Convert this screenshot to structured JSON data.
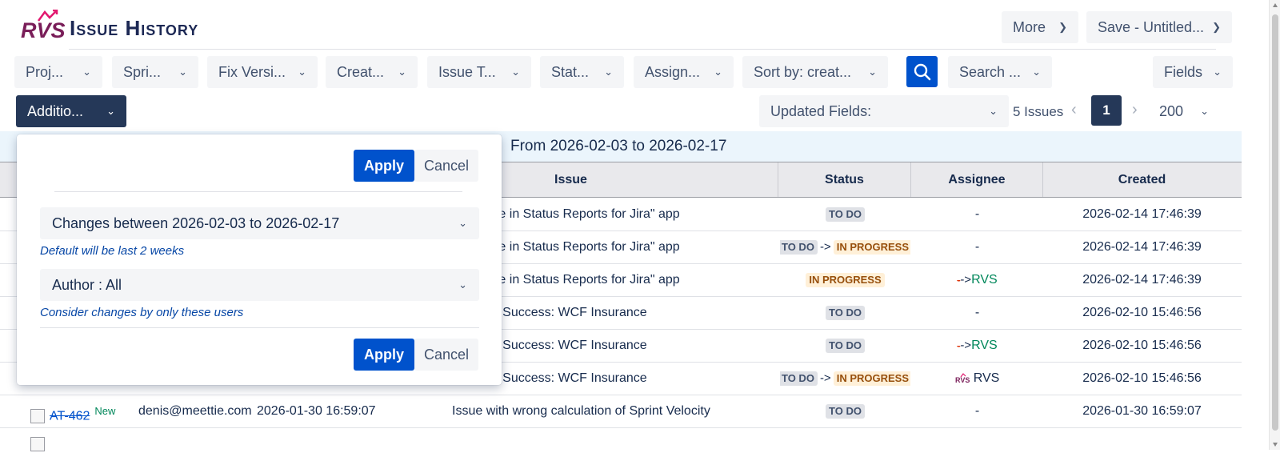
{
  "app": {
    "logo_text": "RVS",
    "title": "Issue History"
  },
  "header": {
    "more_label": "More",
    "save_label": "Save - Untitled..."
  },
  "filters": {
    "project": "Proj...",
    "sprint": "Spri...",
    "fix_version": "Fix Versi...",
    "created": "Creat...",
    "issue_type": "Issue T...",
    "status": "Stat...",
    "assignee": "Assign...",
    "sort_by": "Sort by: creat...",
    "search": "Search ...",
    "fields": "Fields",
    "additional": "Additio...",
    "updated_fields": "Updated Fields:"
  },
  "pager": {
    "issues_count": "5 Issues",
    "current_page": "1",
    "page_size": "200",
    "prev": "‹",
    "next": "›"
  },
  "banner": {
    "text": "From 2026-02-03 to 2026-02-17"
  },
  "table": {
    "headers": {
      "issue": "Issue",
      "status": "Status",
      "assignee": "Assignee",
      "created": "Created"
    },
    "rows": [
      {
        "issue": "the \"Time in Status Reports for Jira\" app",
        "status_from": "TO DO",
        "status_to": "",
        "assignee_old": "",
        "assignee_new": "-",
        "created": "2026-02-14 17:46:39"
      },
      {
        "issue": "the \"Time in Status Reports for Jira\" app",
        "status_from": "TO DO",
        "status_to": "IN PROGRESS",
        "assignee_old": "",
        "assignee_new": "-",
        "created": "2026-02-14 17:46:39"
      },
      {
        "issue": "the \"Time in Status Reports for Jira\" app",
        "status_from": "IN PROGRESS",
        "status_to": "",
        "assignee_old": "-",
        "assignee_new": "RVS",
        "created": "2026-02-14 17:46:39"
      },
      {
        "issue": "ering for Success: WCF Insurance",
        "status_from": "TO DO",
        "status_to": "",
        "assignee_old": "",
        "assignee_new": "-",
        "created": "2026-02-10 15:46:56"
      },
      {
        "issue": "ering for Success: WCF Insurance",
        "status_from": "TO DO",
        "status_to": "",
        "assignee_old": "-",
        "assignee_new": "RVS",
        "created": "2026-02-10 15:46:56"
      },
      {
        "issue": "ering for Success: WCF Insurance",
        "status_from": "TO DO",
        "status_to": "IN PROGRESS",
        "assignee_old": "",
        "assignee_new": "RVS",
        "created": "2026-02-10 15:46:56"
      },
      {
        "key": "AT-462",
        "new_tag": "New",
        "author": "denis@meettie.com",
        "date": "2026-01-30 16:59:07",
        "issue": "Issue with wrong calculation of Sprint Velocity",
        "status_from": "TO DO",
        "status_to": "",
        "assignee_new": "-",
        "created": "2026-01-30 16:59:07"
      }
    ],
    "arrow": "->"
  },
  "panel": {
    "apply_label": "Apply",
    "cancel_label": "Cancel",
    "changes_select": "Changes between 2026-02-03 to 2026-02-17",
    "changes_hint": "Default will be last 2 weeks",
    "author_select": "Author : All",
    "author_hint": "Consider changes by only these users"
  },
  "colors": {
    "primary": "#0052cc",
    "dark": "#253858",
    "todo_bg": "#dfe1e6",
    "inprogress_bg": "#fff0d8",
    "banner_bg": "#ebf5fc"
  }
}
